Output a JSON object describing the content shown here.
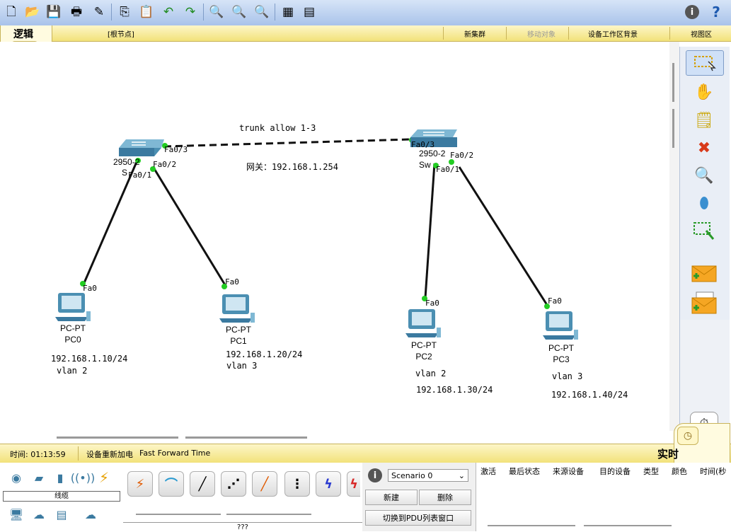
{
  "toolbar": {
    "icons": [
      "new-icon",
      "open-icon",
      "save-icon",
      "print-icon",
      "wizard-icon",
      "copy-icon",
      "paste-icon",
      "undo-icon",
      "redo-icon",
      "zoom-in-icon",
      "zoom-reset-icon",
      "zoom-out-icon",
      "palette-icon",
      "device-template-icon",
      "info-icon",
      "help-icon"
    ]
  },
  "logicbar": {
    "tab_label": "逻辑",
    "root": "[根节点]",
    "new_cluster": "新集群",
    "move_object": "移动对象",
    "set_background": "设备工作区背景",
    "viewport": "视图区"
  },
  "topology": {
    "trunk_label": "trunk allow 1-3",
    "gateway_label": "网关：192.168.1.254",
    "switches": [
      {
        "model": "2950-2",
        "name": "S"
      },
      {
        "model": "2950-2",
        "name": "Sw"
      }
    ],
    "ports": {
      "s0_fa03": "Fa0/3",
      "s0_fa02": "Fa0/2",
      "s0_fa01": "Fa0/1",
      "s1_fa03": "Fa0/3",
      "s1_fa02": "Fa0/2",
      "s1_fa01": "Fa0/1",
      "pc0_fa0": "Fa0",
      "pc1_fa0": "Fa0",
      "pc2_fa0": "Fa0",
      "pc3_fa0": "Fa0"
    },
    "pcs": [
      {
        "type": "PC-PT",
        "name": "PC0",
        "ip": "192.168.1.10/24",
        "vlan": "vlan 2"
      },
      {
        "type": "PC-PT",
        "name": "PC1",
        "ip": "192.168.1.20/24",
        "vlan": "vlan 3"
      },
      {
        "type": "PC-PT",
        "name": "PC2",
        "ip": "192.168.1.30/24",
        "vlan": "vlan 2"
      },
      {
        "type": "PC-PT",
        "name": "PC3",
        "ip": "192.168.1.40/24",
        "vlan": "vlan 3"
      }
    ],
    "link_color": "#111111",
    "link_up_color": "#22cc22"
  },
  "palette": {
    "icons": [
      "select-icon",
      "move-layout-icon",
      "note-icon",
      "delete-icon",
      "inspect-icon",
      "draw-shape-icon",
      "resize-icon",
      "simple-pdu-icon",
      "complex-pdu-icon"
    ]
  },
  "statusbar": {
    "time": "时间: 01:13:59",
    "power_cycle": "设备重新加电",
    "fast_forward": "Fast Forward Time",
    "realtime_label": "实时"
  },
  "bottom": {
    "category_label": "线缆",
    "cable_tooltip": "???",
    "scenario": "Scenario 0",
    "new_button": "新建",
    "delete_button": "删除",
    "switch_pdu_button": "切换到PDU列表窗口",
    "columns": [
      "激活",
      "最后状态",
      "来源设备",
      "目的设备",
      "类型",
      "颜色",
      "时间(秒"
    ]
  }
}
